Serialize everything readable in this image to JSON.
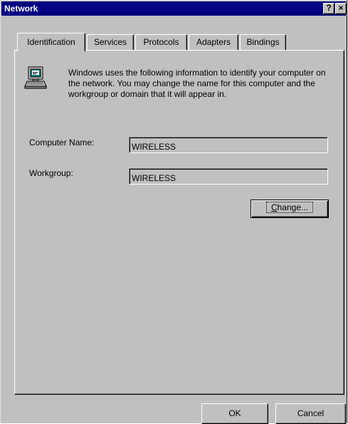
{
  "window": {
    "title": "Network",
    "help_label": "?",
    "close_label": "×"
  },
  "tabs": [
    {
      "label": "Identification",
      "active": true
    },
    {
      "label": "Services"
    },
    {
      "label": "Protocols"
    },
    {
      "label": "Adapters"
    },
    {
      "label": "Bindings"
    }
  ],
  "identification": {
    "icon": "network-computer-icon",
    "description": "Windows uses the following information to identify your computer on the network.  You may change the name for this computer and the workgroup or domain that it will appear in.",
    "computer_name_label": "Computer Name:",
    "computer_name_value": "WIRELESS",
    "workgroup_label": "Workgroup:",
    "workgroup_value": "WIRELESS",
    "change_button": {
      "mnemonic": "C",
      "rest": "hange..."
    }
  },
  "footer": {
    "ok_label": "OK",
    "cancel_label": "Cancel"
  },
  "colors": {
    "title_bar": "#000080",
    "face": "#c0c0c0",
    "highlight": "#ffffff",
    "shadow": "#808080"
  }
}
